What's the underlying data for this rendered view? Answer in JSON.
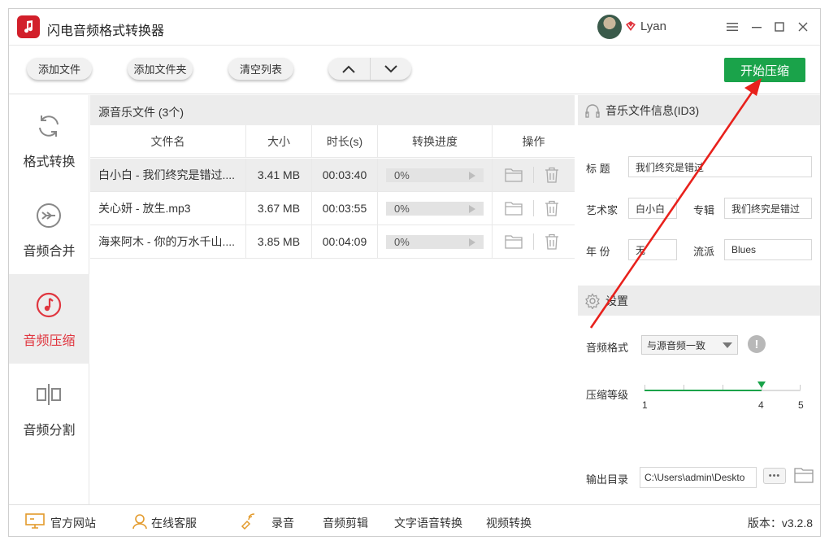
{
  "app": {
    "title": "闪电音频格式转换器",
    "user": "Lyan"
  },
  "toolbar": {
    "add_file": "添加文件",
    "add_folder": "添加文件夹",
    "clear_list": "清空列表",
    "start": "开始压缩"
  },
  "sidebar": {
    "items": [
      {
        "label": "格式转换",
        "icon": "refresh-icon",
        "active": false
      },
      {
        "label": "音频合并",
        "icon": "merge-icon",
        "active": false
      },
      {
        "label": "音频压缩",
        "icon": "music-note-icon",
        "active": true
      },
      {
        "label": "音频分割",
        "icon": "split-icon",
        "active": false
      }
    ]
  },
  "filelist": {
    "title": "源音乐文件 (3个)",
    "columns": [
      "文件名",
      "大小",
      "时长(s)",
      "转换进度",
      "操作"
    ],
    "rows": [
      {
        "name": "白小白 - 我们终究是错过....",
        "size": "3.41 MB",
        "duration": "00:03:40",
        "progress": "0%",
        "progress_value": 0
      },
      {
        "name": "关心妍 - 放生.mp3",
        "size": "3.67 MB",
        "duration": "00:03:55",
        "progress": "0%",
        "progress_value": 0
      },
      {
        "name": "海来阿木 - 你的万水千山....",
        "size": "3.85 MB",
        "duration": "00:04:09",
        "progress": "0%",
        "progress_value": 0
      }
    ]
  },
  "info": {
    "title": "音乐文件信息(ID3)",
    "title_label": "标 题",
    "title_value": "我们终究是错过",
    "artist_label": "艺术家",
    "artist_value": "白小白",
    "album_label": "专辑",
    "album_value": "我们终究是错过",
    "year_label": "年 份",
    "year_value": "无",
    "genre_label": "流派",
    "genre_value": "Blues"
  },
  "settings": {
    "title": "设置",
    "format_label": "音频格式",
    "format_value": "与源音频一致",
    "level_label": "压缩等级",
    "level_min": "1",
    "level_mark": "4",
    "level_max": "5",
    "level_value": 4,
    "output_label": "输出目录",
    "output_value": "C:\\Users\\admin\\Deskto"
  },
  "footer": {
    "website": "官方网站",
    "support": "在线客服",
    "record": "录音",
    "audio_edit": "音频剪辑",
    "tts": "文字语音转换",
    "video": "视频转换",
    "version": "版本：v3.2.8"
  },
  "colors": {
    "accent": "#1aa34a",
    "active": "#e0363f",
    "logo": "#d21f2a",
    "annotation": "#e8211c"
  }
}
